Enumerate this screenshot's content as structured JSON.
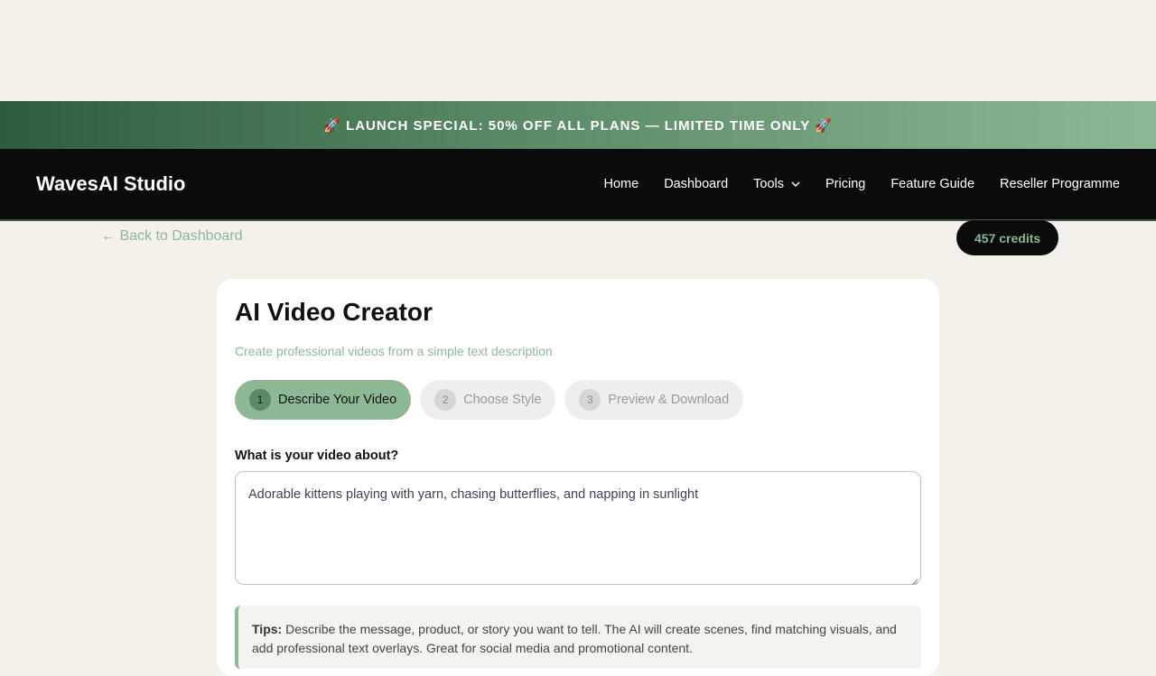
{
  "promo": {
    "text": "🚀 LAUNCH SPECIAL: 50% OFF ALL PLANS — LIMITED TIME ONLY 🚀"
  },
  "nav": {
    "brand": "WavesAI Studio",
    "items": [
      {
        "label": "Home"
      },
      {
        "label": "Dashboard"
      },
      {
        "label": "Tools"
      },
      {
        "label": "Pricing"
      },
      {
        "label": "Feature Guide"
      },
      {
        "label": "Reseller Programme"
      }
    ]
  },
  "subbar": {
    "back_label": "← Back to Dashboard",
    "credits_label": "457 credits"
  },
  "main": {
    "title": "AI Video Creator",
    "subtitle": "Create professional videos from a simple text description",
    "steps": [
      {
        "num": "1",
        "label": "Describe Your Video"
      },
      {
        "num": "2",
        "label": "Choose Style"
      },
      {
        "num": "3",
        "label": "Preview & Download"
      }
    ],
    "field_label": "What is your video about?",
    "field_value": "Adorable kittens playing with yarn, chasing butterflies, and napping in sunlight",
    "tips_label": "Tips:",
    "tips_text": " Describe the message, product, or story you want to tell. The AI will create scenes, find matching visuals, and add professional text overlays. Great for social media and promotional content."
  },
  "colors": {
    "accent": "#8db895",
    "accent_dark": "#2e5c40",
    "nav_bg": "#0b0b0b",
    "page_bg": "#f4f0ea"
  },
  "icons": {
    "tools_dropdown": "chevron-down-icon",
    "resize": "resize-grip-icon"
  }
}
